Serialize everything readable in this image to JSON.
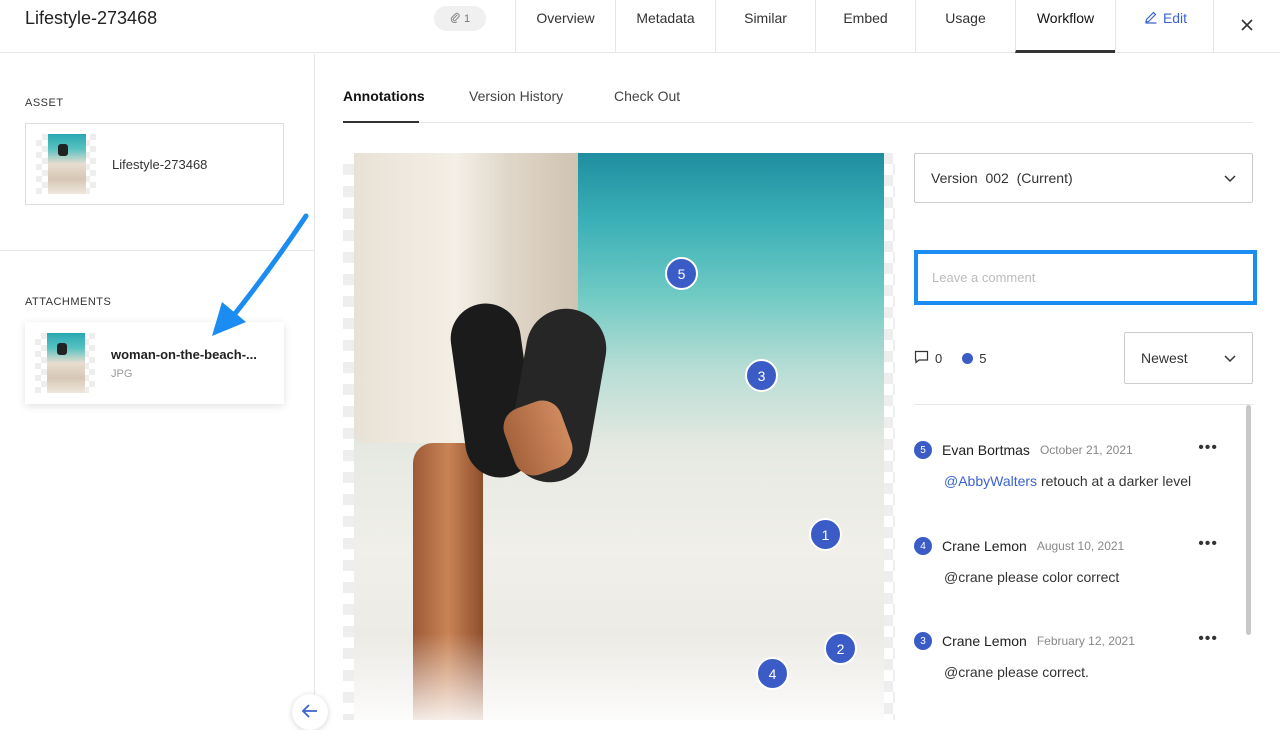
{
  "header": {
    "title": "Lifestyle-273468",
    "attachment_count": "1",
    "tabs": [
      "Overview",
      "Metadata",
      "Similar",
      "Embed",
      "Usage",
      "Workflow"
    ],
    "active_tab": "Workflow",
    "edit_label": "Edit"
  },
  "sidebar": {
    "asset_label": "ASSET",
    "asset_name": "Lifestyle-273468",
    "attachments_label": "ATTACHMENTS",
    "attachment_name": "woman-on-the-beach-...",
    "attachment_type": "JPG"
  },
  "subtabs": [
    "Annotations",
    "Version History",
    "Check Out"
  ],
  "annotation_markers": [
    "5",
    "3",
    "1",
    "2",
    "4"
  ],
  "version": {
    "label": "Version",
    "number": "002",
    "status": "(Current)"
  },
  "comment_input": {
    "placeholder": "Leave a comment"
  },
  "counts": {
    "comments": "0",
    "annotations": "5"
  },
  "sort": {
    "selected": "Newest"
  },
  "comments": [
    {
      "num": "5",
      "author": "Evan Bortmas",
      "date": "October 21, 2021",
      "mention": "@AbbyWalters",
      "text": " retouch at a darker level"
    },
    {
      "num": "4",
      "author": "Crane Lemon",
      "date": "August 10, 2021",
      "mention": "",
      "text": "@crane please color correct"
    },
    {
      "num": "3",
      "author": "Crane Lemon",
      "date": "February 12, 2021",
      "mention": "",
      "text": "@crane please correct."
    }
  ],
  "colors": {
    "accent": "#3b5cc6",
    "link": "#3b63d1",
    "focus": "#1a8cf2"
  }
}
